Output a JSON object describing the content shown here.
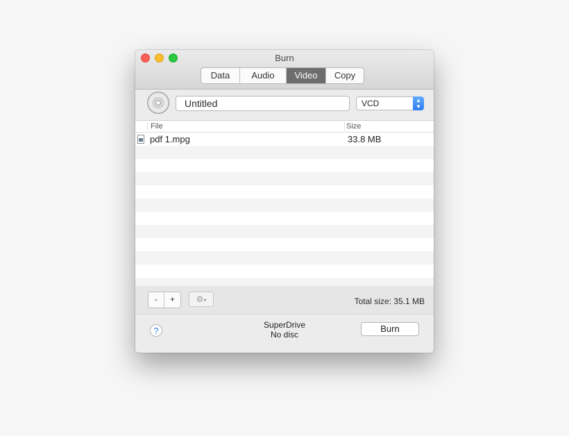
{
  "window": {
    "title": "Burn"
  },
  "tabs": [
    {
      "label": "Data",
      "active": false
    },
    {
      "label": "Audio",
      "active": false
    },
    {
      "label": "Video",
      "active": true
    },
    {
      "label": "Copy",
      "active": false
    }
  ],
  "disc": {
    "name_value": "Untitled",
    "format": "VCD"
  },
  "table": {
    "columns": [
      "File",
      "Size"
    ],
    "rows": [
      {
        "name": "pdf 1.mpg",
        "size": "33.8 MB"
      }
    ]
  },
  "toolbar": {
    "remove_label": "-",
    "add_label": "+",
    "gear_icon": "gear-icon",
    "total_size": "Total size: 35.1 MB"
  },
  "footer": {
    "help_label": "?",
    "drive_name": "SuperDrive",
    "drive_status": "No disc",
    "burn_label": "Burn"
  },
  "colors": {
    "accent": "#2f7ff0",
    "active_tab": "#6d6d6d",
    "close": "#fc5f57",
    "minimize": "#fdbc2e",
    "maximize": "#28c840"
  }
}
